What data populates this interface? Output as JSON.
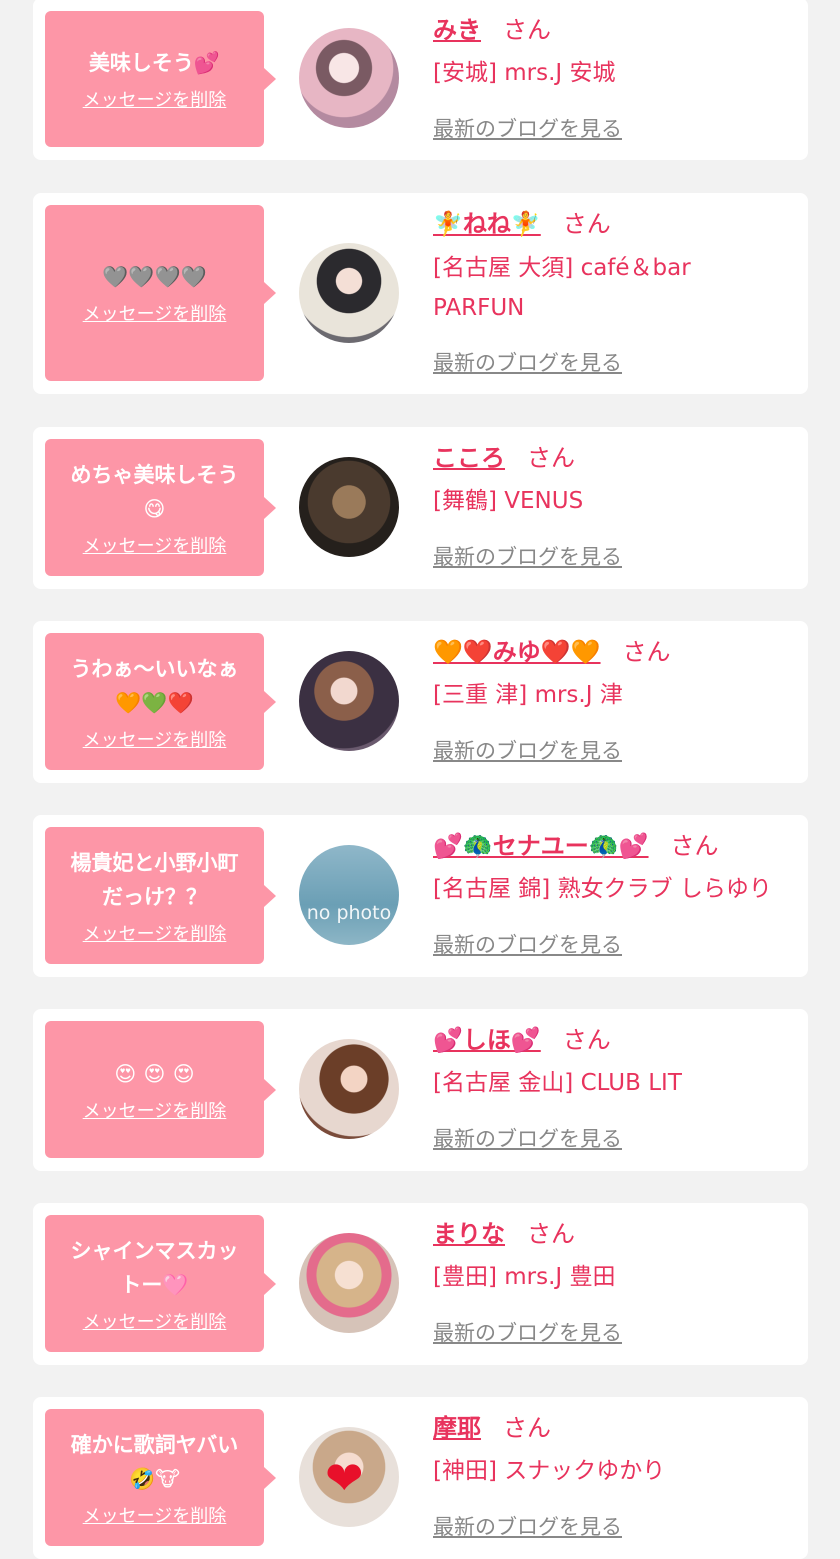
{
  "entries": [
    {
      "message": "美味しそう💕",
      "delete_label": "メッセージを削除",
      "name": "みき",
      "honorific": "さん",
      "shop": "[安城] mrs.J 安城",
      "blog_link": "最新のブログを見る"
    },
    {
      "message": "🩶🩶🩶🩶",
      "delete_label": "メッセージを削除",
      "name": "🧚ねね🧚",
      "honorific": "さん",
      "shop": "[名古屋 大須] café＆bar\nPARFUN",
      "blog_link": "最新のブログを見る"
    },
    {
      "message": "めちゃ美味しそう\n😋",
      "delete_label": "メッセージを削除",
      "name": "こころ",
      "honorific": "さん",
      "shop": "[舞鶴] VENUS",
      "blog_link": "最新のブログを見る"
    },
    {
      "message": "うわぁ〜いいなぁ\n🧡💚❤️",
      "delete_label": "メッセージを削除",
      "name": "🧡❤️みゆ❤️🧡",
      "honorific": "さん",
      "shop": "[三重 津] mrs.J 津",
      "blog_link": "最新のブログを見る"
    },
    {
      "message": "楊貴妃と小野小町\nだっけ？？",
      "delete_label": "メッセージを削除",
      "name": "💕🦚セナユー🦚💕",
      "honorific": "さん",
      "shop": "[名古屋 錦] 熟女クラブ しらゆり",
      "blog_link": "最新のブログを見る",
      "avatar_text": "no photo"
    },
    {
      "message": "😍 😍 😍",
      "delete_label": "メッセージを削除",
      "name": "💕しほ💕",
      "honorific": "さん",
      "shop": "[名古屋 金山] CLUB LIT",
      "blog_link": "最新のブログを見る"
    },
    {
      "message": "シャインマスカッ\nトー🩷",
      "delete_label": "メッセージを削除",
      "name": "まりな",
      "honorific": "さん",
      "shop": "[豊田] mrs.J 豊田",
      "blog_link": "最新のブログを見る"
    },
    {
      "message": "確かに歌詞ヤバい\n🤣🐮",
      "delete_label": "メッセージを削除",
      "name": "摩耶",
      "honorific": "さん",
      "shop": "[神田] スナックゆかり",
      "blog_link": "最新のブログを見る"
    }
  ],
  "colors": {
    "accent": "#e8335d",
    "bubble": "#fd96a7",
    "link_gray": "#888888",
    "background": "#f2f2f2"
  }
}
